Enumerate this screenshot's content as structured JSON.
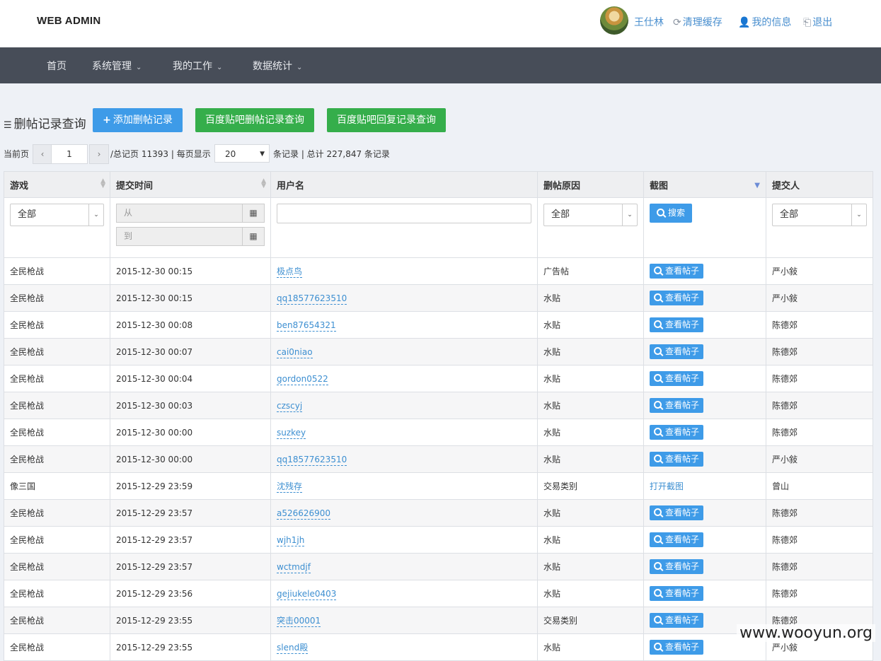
{
  "brand": "WEB ADMIN",
  "user": {
    "name": "王仕林",
    "clear_cache": "清理缓存",
    "my_info": "我的信息",
    "logout": "退出"
  },
  "nav": {
    "home": "首页",
    "system": "系统管理",
    "work": "我的工作",
    "stats": "数据统计"
  },
  "page": {
    "title": "删帖记录查询",
    "add_btn": "添加删帖记录",
    "baidu_delete_btn": "百度贴吧删帖记录查询",
    "baidu_reply_btn": "百度贴吧回复记录查询"
  },
  "pager": {
    "current_label": "当前页",
    "prev": "‹",
    "next": "›",
    "current_page": "1",
    "total_pages_label": "/总记页 11393 | 每页显示",
    "page_size": "20",
    "total_label": "条记录 | 总计 227,847 条记录"
  },
  "table": {
    "headers": {
      "game": "游戏",
      "time": "提交时间",
      "user": "用户名",
      "reason": "删帖原因",
      "shot": "截图",
      "submitter": "提交人"
    },
    "filter": {
      "game": "全部",
      "date_from": "从",
      "date_to": "到",
      "reason": "全部",
      "search": "搜索",
      "submitter": "全部"
    },
    "rows": [
      {
        "game": "全民枪战",
        "time": "2015-12-30 00:15",
        "user": "极点鸟",
        "reason": "广告帖",
        "shot": "查看帖子",
        "submitter": "严小敍"
      },
      {
        "game": "全民枪战",
        "time": "2015-12-30 00:15",
        "user": "qq18577623510",
        "reason": "水贴",
        "shot": "查看帖子",
        "submitter": "严小敍"
      },
      {
        "game": "全民枪战",
        "time": "2015-12-30 00:08",
        "user": "ben87654321",
        "reason": "水贴",
        "shot": "查看帖子",
        "submitter": "陈德郊"
      },
      {
        "game": "全民枪战",
        "time": "2015-12-30 00:07",
        "user": "cai0niao",
        "reason": "水贴",
        "shot": "查看帖子",
        "submitter": "陈德郊"
      },
      {
        "game": "全民枪战",
        "time": "2015-12-30 00:04",
        "user": "gordon0522",
        "reason": "水贴",
        "shot": "查看帖子",
        "submitter": "陈德郊"
      },
      {
        "game": "全民枪战",
        "time": "2015-12-30 00:03",
        "user": "czscyj",
        "reason": "水贴",
        "shot": "查看帖子",
        "submitter": "陈德郊"
      },
      {
        "game": "全民枪战",
        "time": "2015-12-30 00:00",
        "user": "suzkey",
        "reason": "水贴",
        "shot": "查看帖子",
        "submitter": "陈德郊"
      },
      {
        "game": "全民枪战",
        "time": "2015-12-30 00:00",
        "user": "qq18577623510",
        "reason": "水贴",
        "shot": "查看帖子",
        "submitter": "严小敍"
      },
      {
        "game": "像三国",
        "time": "2015-12-29 23:59",
        "user": "沈残存",
        "reason": "交易类别",
        "shot": "打开截图",
        "submitter": "曾山"
      },
      {
        "game": "全民枪战",
        "time": "2015-12-29 23:57",
        "user": "a526626900",
        "reason": "水贴",
        "shot": "查看帖子",
        "submitter": "陈德郊"
      },
      {
        "game": "全民枪战",
        "time": "2015-12-29 23:57",
        "user": "wjh1jh",
        "reason": "水贴",
        "shot": "查看帖子",
        "submitter": "陈德郊"
      },
      {
        "game": "全民枪战",
        "time": "2015-12-29 23:57",
        "user": "wctmdjf",
        "reason": "水贴",
        "shot": "查看帖子",
        "submitter": "陈德郊"
      },
      {
        "game": "全民枪战",
        "time": "2015-12-29 23:56",
        "user": "gejiukele0403",
        "reason": "水贴",
        "shot": "查看帖子",
        "submitter": "陈德郊"
      },
      {
        "game": "全民枪战",
        "time": "2015-12-29 23:55",
        "user": "突击00001",
        "reason": "交易类别",
        "shot": "查看帖子",
        "submitter": "陈德郊"
      },
      {
        "game": "全民枪战",
        "time": "2015-12-29 23:55",
        "user": "slend殿",
        "reason": "水贴",
        "shot": "查看帖子",
        "submitter": "严小敍"
      }
    ]
  },
  "watermark": "www.wooyun.org",
  "colors": {
    "nav_bg": "#474d58",
    "primary": "#3e9be8",
    "success": "#35ae4b",
    "link": "#3d8fd1"
  }
}
